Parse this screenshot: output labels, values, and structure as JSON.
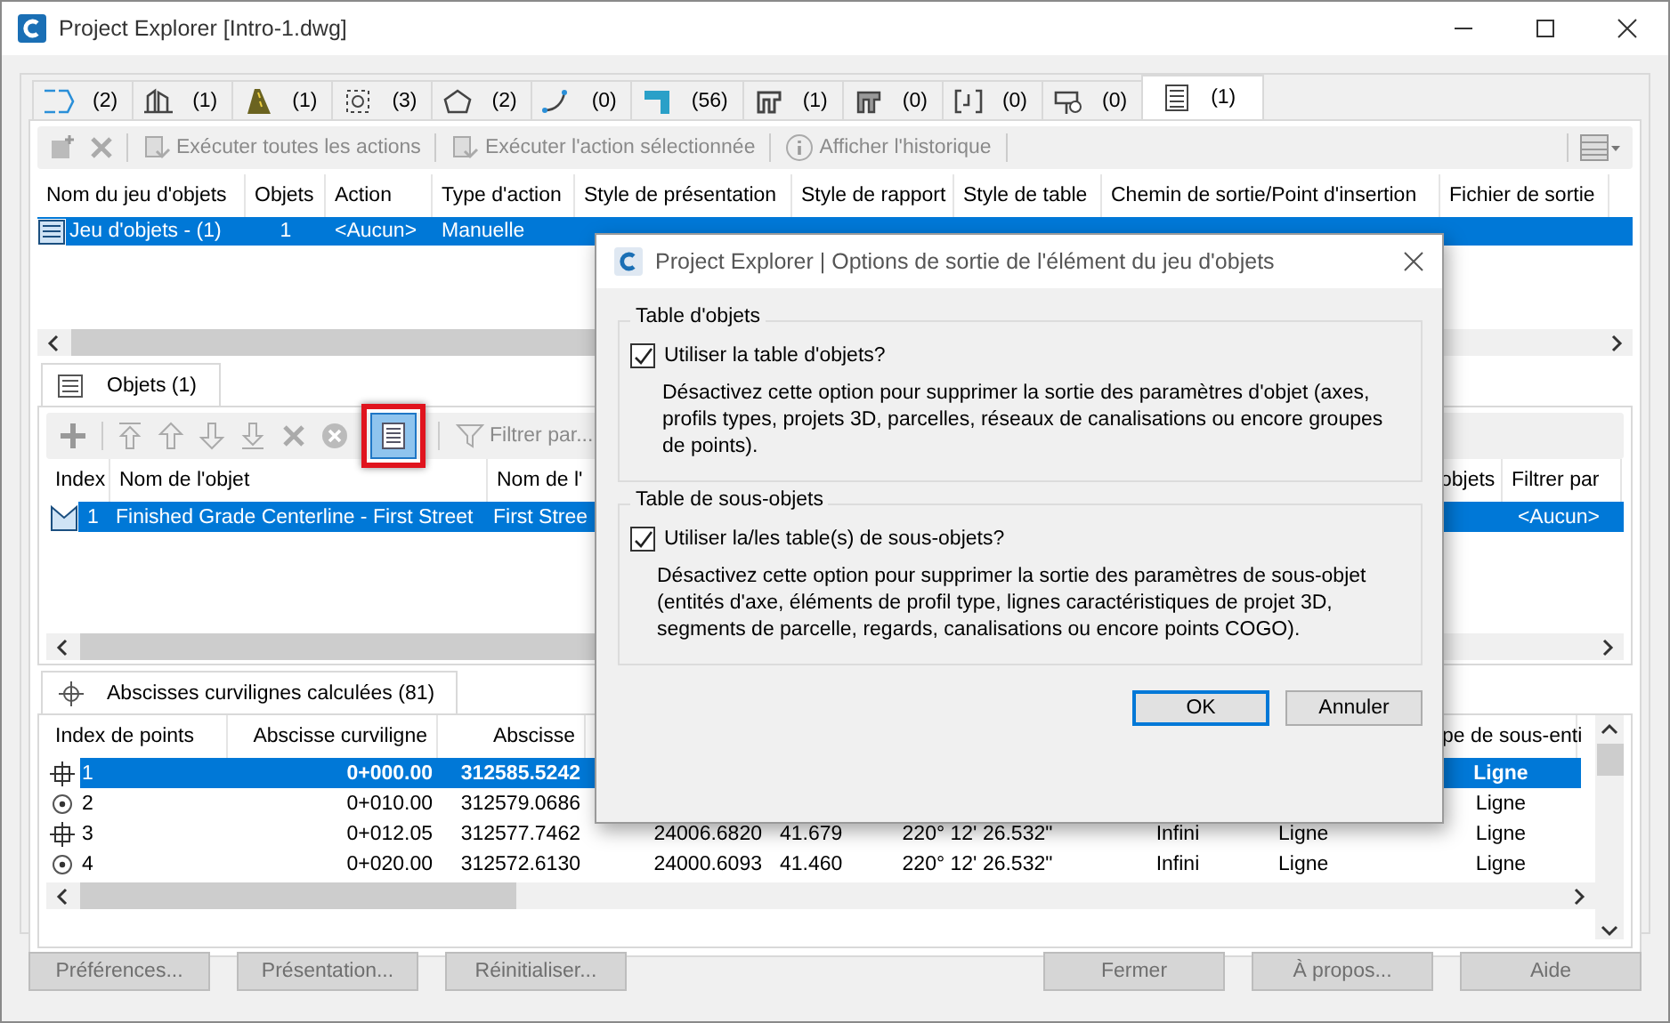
{
  "window": {
    "title": "Project Explorer [Intro-1.dwg]"
  },
  "tabs": [
    {
      "count": "(2)",
      "selected": false
    },
    {
      "count": "(1)",
      "selected": false
    },
    {
      "count": "(1)",
      "selected": false
    },
    {
      "count": "(3)",
      "selected": false
    },
    {
      "count": "(2)",
      "selected": false
    },
    {
      "count": "(0)",
      "selected": false
    },
    {
      "count": "(56)",
      "selected": false
    },
    {
      "count": "(1)",
      "selected": false
    },
    {
      "count": "(0)",
      "selected": false
    },
    {
      "count": "(0)",
      "selected": false
    },
    {
      "count": "(0)",
      "selected": false
    },
    {
      "count": "(1)",
      "selected": true
    }
  ],
  "toolbar": {
    "actions": [
      {
        "label": "Exécuter toutes les actions",
        "disabled": true
      },
      {
        "label": "Exécuter l'action sélectionnée",
        "disabled": true
      },
      {
        "label": "Afficher l'historique",
        "disabled": true
      }
    ]
  },
  "object_sets": {
    "columns": [
      "Nom du jeu d'objets",
      "Objets",
      "Action",
      "Type d'action",
      "Style de présentation",
      "Style de rapport",
      "Style de table",
      "Chemin de sortie/Point d'insertion",
      "Fichier de sortie"
    ],
    "rows": [
      {
        "cells": [
          "Jeu d'objets - (1)",
          "1",
          "<Aucun>",
          "Manuelle"
        ],
        "selected": true
      }
    ]
  },
  "objects_panel": {
    "tab": {
      "label": "Objets (1)",
      "selected": true
    },
    "table_button": {
      "pressed": true,
      "highlighted": true
    },
    "filter_label": "Filtrer par...",
    "columns": [
      "Index",
      "Nom de l'objet",
      "Nom de l'",
      null,
      "objets",
      "Filtrer par"
    ],
    "rows": [
      {
        "cells": [
          "1",
          "Finished Grade Centerline - First Street",
          "First Stree",
          null,
          null,
          "<Aucun>"
        ],
        "selected": true
      }
    ]
  },
  "stations_panel": {
    "tab": {
      "label": "Abscisses curvilignes calculées (81)",
      "selected": true
    },
    "columns": [
      "Index de points",
      "Abscisse curviligne",
      "Abscisse",
      null,
      null,
      null,
      null,
      null,
      "pe de sous-enti"
    ],
    "rows": [
      {
        "kind": "geometry",
        "selected": true,
        "cells": [
          "1",
          "0+000.00",
          "312585.5242",
          null,
          null,
          null,
          null,
          null,
          "Ligne"
        ]
      },
      {
        "kind": "station",
        "selected": false,
        "cells": [
          "2",
          "0+010.00",
          "312579.0686",
          null,
          null,
          null,
          null,
          null,
          "Ligne"
        ]
      },
      {
        "kind": "geometry",
        "selected": false,
        "cells": [
          "3",
          "0+012.05",
          "312577.7462",
          "24006.6820",
          "41.679",
          "220° 12' 26.532\"",
          "Infini",
          "Ligne",
          "Ligne"
        ]
      },
      {
        "kind": "station",
        "selected": false,
        "cells": [
          "4",
          "0+020.00",
          "312572.6130",
          "24000.6093",
          "41.460",
          "220° 12' 26.532\"",
          "Infini",
          "Ligne",
          "Ligne"
        ]
      }
    ]
  },
  "buttons": [
    {
      "label": "Préférences...",
      "disabled": true
    },
    {
      "label": "Présentation...",
      "disabled": true
    },
    {
      "label": "Réinitialiser...",
      "disabled": true
    },
    {
      "label": "Fermer",
      "disabled": true
    },
    {
      "label": "À propos...",
      "disabled": true
    },
    {
      "label": "Aide",
      "disabled": true
    }
  ],
  "dialog": {
    "title": "Project Explorer | Options de sortie de l'élément du jeu d'objets",
    "groups": [
      {
        "title": "Table d'objets",
        "checkbox": {
          "label": "Utiliser la table d'objets?",
          "checked": true
        },
        "description": "Désactivez cette option pour supprimer la sortie des paramètres d'objet (axes, profils types, projets 3D, parcelles, réseaux de canalisations ou encore groupes de points)."
      },
      {
        "title": "Table de sous-objets",
        "checkbox": {
          "label": "Utiliser la/les table(s) de sous-objets?",
          "checked": true
        },
        "description": "Désactivez cette option pour supprimer la sortie des paramètres de sous-objet (entités d'axe, éléments de profil type, lignes caractéristiques de projet 3D, segments de parcelle, regards, canalisations ou encore points COGO)."
      }
    ],
    "buttons": [
      {
        "label": "OK",
        "default": true
      },
      {
        "label": "Annuler",
        "default": false
      }
    ]
  }
}
